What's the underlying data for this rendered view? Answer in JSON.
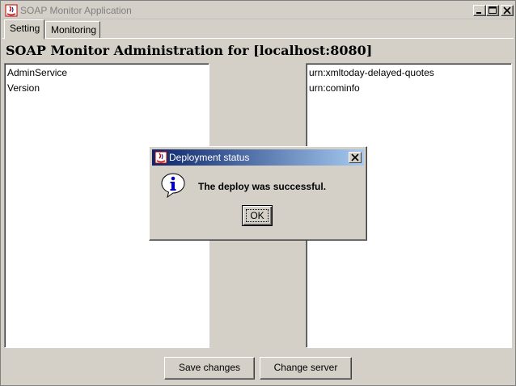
{
  "window": {
    "title": "SOAP Monitor Application",
    "controls": [
      "minimize",
      "maximize",
      "close"
    ]
  },
  "tabs": [
    {
      "label": "Setting",
      "active": true
    },
    {
      "label": "Monitoring",
      "active": false
    }
  ],
  "main": {
    "heading": "SOAP Monitor Administration for [localhost:8080]",
    "left_list": [
      "AdminService",
      "Version"
    ],
    "right_list": [
      "urn:xmltoday-delayed-quotes",
      "urn:cominfo"
    ]
  },
  "buttons": {
    "save": "Save changes",
    "change_server": "Change server"
  },
  "dialog": {
    "title": "Deployment status",
    "message": "The deploy was successful.",
    "ok_label": "OK",
    "icon": "info-icon"
  },
  "colors": {
    "background": "#d4d0c8",
    "dialog_title_start": "#0a246a",
    "dialog_title_end": "#a6caf0",
    "info_icon": "#0000c0"
  }
}
